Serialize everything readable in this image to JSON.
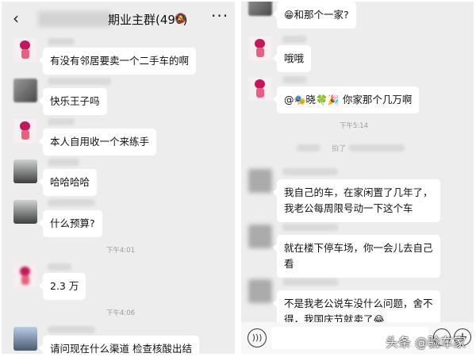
{
  "left": {
    "header": {
      "back_icon": "‹",
      "title": "期业主群(496)",
      "more_icon": "···"
    },
    "messages": [
      {
        "text": "有没有邻居要卖一个二手车的啊"
      },
      {
        "text": "快乐王子吗"
      },
      {
        "text": "本人自用收一个来练手"
      },
      {
        "text": "哈哈哈哈"
      },
      {
        "text": "什么预算?"
      },
      {
        "text": "2.3 万"
      },
      {
        "text": "请问现在什么渠道 检查核酸出结"
      }
    ],
    "times": [
      "下午4:01",
      "下午4:06"
    ]
  },
  "right": {
    "messages": [
      {
        "text": "和那个一家?",
        "emoji": "😁"
      },
      {
        "text": "哦哦"
      },
      {
        "prefix": "@",
        "name": "晓",
        "text": "你家那个几万啊",
        "emoji1": "🎭",
        "emoji2": "🍀",
        "emoji3": "🎉"
      },
      {
        "text_line1": "我自己的车，在家闲置了几年了，",
        "text_line2": "我老公每周限号动一下这个车"
      },
      {
        "text_line1": "就在楼下停车场，你一会儿去自己",
        "text_line2": "看"
      },
      {
        "text_line1": "不是我老公说车没什么问题，舍不",
        "text_line2": "得，我国庆节就卖了",
        "emoji": "😂"
      }
    ],
    "time": "下午5:14",
    "system_partial": "拍了"
  },
  "watermark": "头条 @验车家"
}
